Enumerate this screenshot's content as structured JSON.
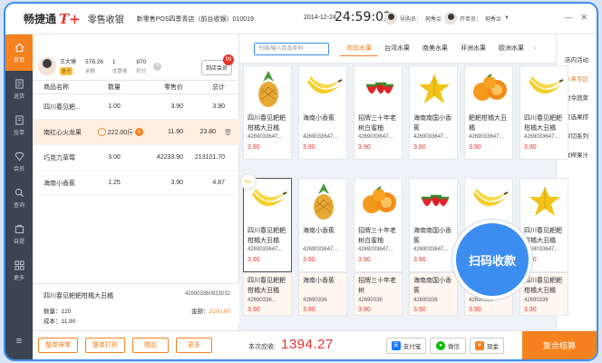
{
  "header": {
    "brand": "畅捷通",
    "brand_tplus": "T+",
    "app_name": "零售收银",
    "store_info": "新零售POS四季青店（前台收银）010019",
    "date": "2014-12-24",
    "time": "24:59:02",
    "user1_role": "导购员：",
    "user1_name": "何秀兰",
    "user2_role": "开单员：",
    "user2_name": "何秀兰"
  },
  "sidebar": {
    "items": [
      {
        "label": "首页",
        "icon": "home-icon"
      },
      {
        "label": "退货",
        "icon": "return-icon"
      },
      {
        "label": "挂单",
        "icon": "hold-order-icon"
      },
      {
        "label": "会员",
        "icon": "member-icon"
      },
      {
        "label": "查询",
        "icon": "search-icon"
      },
      {
        "label": "自提",
        "icon": "pickup-icon"
      },
      {
        "label": "更多",
        "icon": "more-icon"
      }
    ],
    "menu_icon": "≡"
  },
  "member": {
    "name": "王大锤",
    "level": "金卡",
    "stats": [
      {
        "value": "578.26",
        "label": "余额"
      },
      {
        "value": "1",
        "label": "优惠卷"
      },
      {
        "value": "870",
        "label": "积分"
      }
    ],
    "store_button": "到店会员",
    "badge": "99"
  },
  "cart": {
    "headers": [
      "商品名称",
      "数量",
      "零售价",
      "总计"
    ],
    "rows": [
      {
        "name": "四川春见耙...",
        "qty": "1.00",
        "price": "3.90",
        "total": "3.90"
      },
      {
        "name": "南红心火龙果",
        "qty": "222.00斤",
        "price": "11.90",
        "total": "23.80"
      },
      {
        "name": "巧克力草莓",
        "qty": "3.00",
        "price": "42233.90",
        "total": "213101.70"
      },
      {
        "name": "海南小香蕉",
        "qty": "1.25",
        "price": "3.90",
        "total": "4.87"
      }
    ]
  },
  "detail": {
    "name": "四川春见耙耙柑橘大丑橘",
    "code": "426903360923032",
    "stock_label": "数量：120",
    "amount_label": "金额：",
    "amount_value": "2100.00",
    "cost_label": "成本：11.90"
  },
  "search": {
    "placeholder": "扫描/输入商品条码"
  },
  "categories": {
    "tabs": [
      "肉馅水果",
      "台湾水果",
      "南美水果",
      "非洲水果",
      "欧洲水果"
    ],
    "active_index": 0
  },
  "right_nav": [
    "店内活动",
    "水果专区",
    "时令蔬菜",
    "星选果捞",
    "果切系列",
    "鲜榨果汁"
  ],
  "products": [
    {
      "name": "四川春见耙耙柑橘大丑橘",
      "code": "4269033647...",
      "price": "3.90",
      "fruit": "pineapple"
    },
    {
      "name": "海南小香蕉",
      "code": "4269033647...",
      "price": "3.90",
      "fruit": "banana"
    },
    {
      "name": "招牌三十年老树白蜜柚",
      "code": "4269033647...",
      "price": "3.90",
      "fruit": "strawberry"
    },
    {
      "name": "海南南国小香蕉",
      "code": "4269033647...",
      "price": "3.90",
      "fruit": "starfruit"
    },
    {
      "name": "耙耙柑橘大丑橘",
      "code": "4269033647...",
      "price": "3.90",
      "fruit": "orange"
    },
    {
      "name": "四川春见耙耙柑橘大丑橘",
      "code": "4269033647...",
      "price": "3.90",
      "fruit": "banana"
    },
    {
      "name": "四川春见耙耙柑橘大丑橘",
      "code": "4269033647...",
      "price": "3.90",
      "fruit": "banana"
    },
    {
      "name": "海南小香蕉",
      "code": "4269033647...",
      "price": "3.90",
      "fruit": "pineapple"
    },
    {
      "name": "招牌三十年老树白蜜柚",
      "code": "4269033647...",
      "price": "3.90",
      "fruit": "orange"
    },
    {
      "name": "海南南国小香蕉",
      "code": "4269033647...",
      "price": "3.90",
      "fruit": "strawberry"
    },
    {
      "name": "耙耙柑橘大丑橘",
      "code": "4269033647...",
      "price": "3.90",
      "fruit": "banana"
    },
    {
      "name": "四川春见耙耙柑橘大丑橘",
      "code": "4269033647...",
      "price": "3.90",
      "fruit": "starfruit"
    },
    {
      "name": "四川春见耙耙柑橘大丑橘",
      "code": "42690336...",
      "price": "3.90"
    },
    {
      "name": "海南小香蕉",
      "code": "42690336",
      "price": "3.90"
    },
    {
      "name": "招牌三十年老树",
      "code": "42690336",
      "price": "3.90"
    },
    {
      "name": "海南南国小香蕉",
      "code": "42690336",
      "price": "3.90"
    },
    {
      "name": "耙耙柑橘大丑橘",
      "code": "42690336",
      "price": "3.90"
    },
    {
      "name": "四川春见耙耙柑橘大丑橘",
      "code": "42690336",
      "price": "3.90"
    }
  ],
  "scan": {
    "label": "扫码收款"
  },
  "bottom": {
    "buttons": [
      "整单抹零",
      "整单打折",
      "赠品",
      "更多"
    ],
    "pay_label": "本次应收:",
    "pay_amount": "1394.27",
    "pay_methods": [
      {
        "label": "支付宝",
        "icon": "alipay-icon",
        "color": "#1677ff"
      },
      {
        "label": "微信",
        "icon": "wechat-icon",
        "color": "#09bb07"
      },
      {
        "label": "现金",
        "icon": "cash-icon",
        "color": "#f5821f"
      }
    ],
    "settle": "复合结算"
  },
  "colors": {
    "accent": "#f5821f",
    "price": "#e8322c",
    "sidebar": "#3a4452",
    "scan": "#3b8df0"
  }
}
